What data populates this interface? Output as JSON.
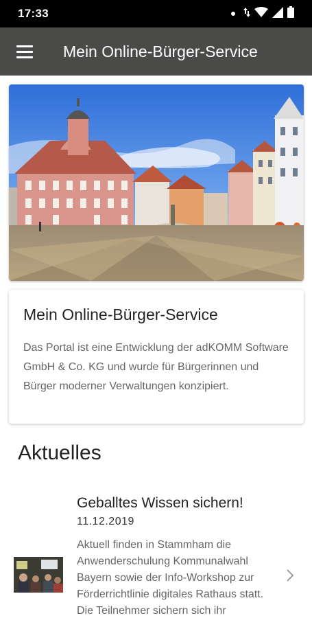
{
  "status_bar": {
    "time": "17:33",
    "icons": [
      "notification-dot-icon",
      "data-arrows-icon",
      "wifi-icon",
      "signal-icon",
      "battery-icon"
    ]
  },
  "app_bar": {
    "title": "Mein Online-Bürger-Service",
    "background": "#4a4a48"
  },
  "hero": {
    "image": "town-square-photo"
  },
  "info_card": {
    "title": "Mein Online-Bürger-Service",
    "text": "Das Portal ist eine Entwicklung der adKOMM Software GmbH & Co. KG und wurde für Bürgerinnen und Bürger moderner Verwaltungen konzipiert."
  },
  "news": {
    "section_title": "Aktuelles",
    "items": [
      {
        "title": "Geballtes Wissen sichern!",
        "date": "11.12.2019",
        "text": "Aktuell finden in Stammham die Anwenderschulung Kommunalwahl Bayern sowie der Info-Workshop zur Förderrichtlinie digitales Rathaus statt. Die Teilnehmer sichern sich ihr",
        "thumbnail": "workshop-photo"
      }
    ]
  }
}
